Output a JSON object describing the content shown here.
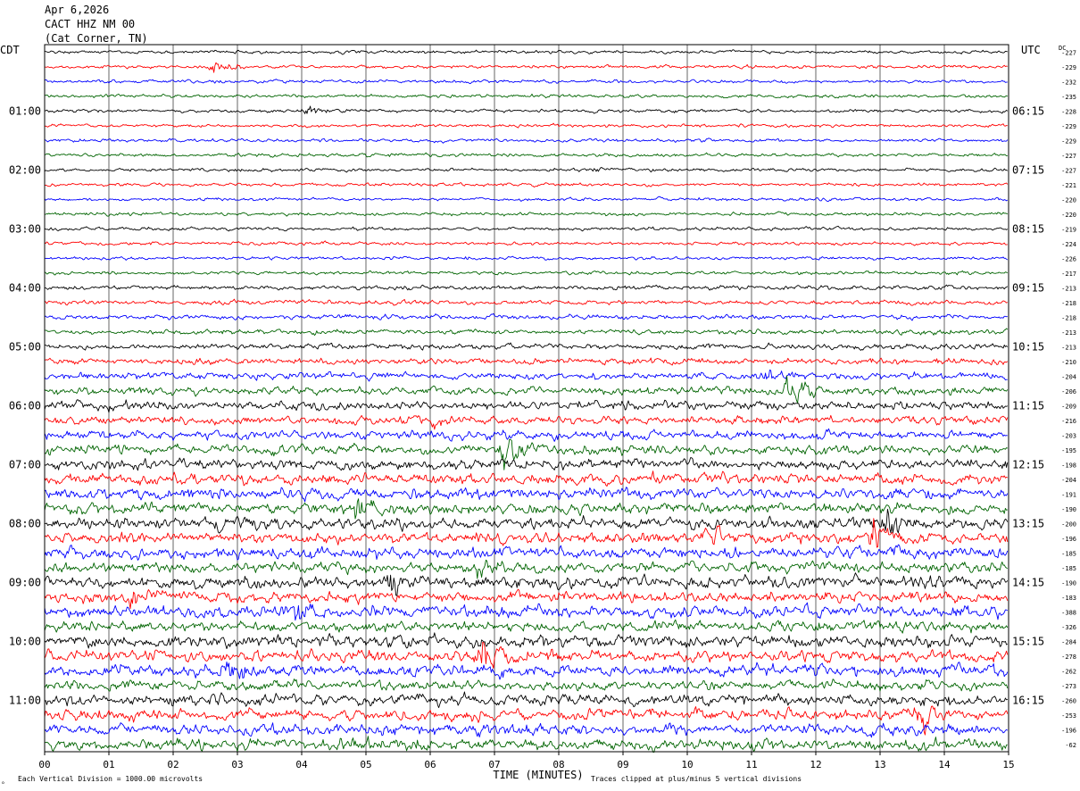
{
  "header": {
    "date": "Apr 6,2026",
    "station": "CACT HHZ NM 00",
    "location": "(Cat Corner, TN)"
  },
  "left_zone_label": "CDT",
  "right_zone_label": "UTC",
  "dc_label": "DC",
  "footer": {
    "scale_note": "Each Vertical Division = 1000.00 microvolts",
    "clip_note": "Traces clipped at plus/minus 5 vertical divisions",
    "corner_mark": "ₒ"
  },
  "colors": {
    "trace_cycle": [
      "#000000",
      "#ff0000",
      "#0000ff",
      "#006400"
    ],
    "grid": "#000000",
    "background": "#ffffff"
  },
  "chart_data": {
    "type": "line",
    "title": "",
    "xlabel": "TIME (MINUTES)",
    "ylabel": "",
    "xlim": [
      0,
      15
    ],
    "x_ticks": [
      "00",
      "01",
      "02",
      "03",
      "04",
      "05",
      "06",
      "07",
      "08",
      "09",
      "10",
      "11",
      "12",
      "13",
      "14",
      "15"
    ],
    "trace_count": 48,
    "trace_minutes": 15,
    "left_hour_labels": [
      {
        "trace": 4,
        "label": "01:00"
      },
      {
        "trace": 8,
        "label": "02:00"
      },
      {
        "trace": 12,
        "label": "03:00"
      },
      {
        "trace": 16,
        "label": "04:00"
      },
      {
        "trace": 20,
        "label": "05:00"
      },
      {
        "trace": 24,
        "label": "06:00"
      },
      {
        "trace": 28,
        "label": "07:00"
      },
      {
        "trace": 32,
        "label": "08:00"
      },
      {
        "trace": 36,
        "label": "09:00"
      },
      {
        "trace": 40,
        "label": "10:00"
      },
      {
        "trace": 44,
        "label": "11:00"
      }
    ],
    "right_hour_labels": [
      {
        "trace": 4,
        "label": "06:15"
      },
      {
        "trace": 8,
        "label": "07:15"
      },
      {
        "trace": 12,
        "label": "08:15"
      },
      {
        "trace": 16,
        "label": "09:15"
      },
      {
        "trace": 20,
        "label": "10:15"
      },
      {
        "trace": 24,
        "label": "11:15"
      },
      {
        "trace": 28,
        "label": "12:15"
      },
      {
        "trace": 32,
        "label": "13:15"
      },
      {
        "trace": 36,
        "label": "14:15"
      },
      {
        "trace": 40,
        "label": "15:15"
      },
      {
        "trace": 44,
        "label": "16:15"
      }
    ],
    "dc_offsets": [
      "-227",
      "-229",
      "-232",
      "-235",
      "-228",
      "-229",
      "-229",
      "-227",
      "-227",
      "-221",
      "-220",
      "-220",
      "-219",
      "-224",
      "-226",
      "-217",
      "-213",
      "-218",
      "-218",
      "-213",
      "-213",
      "-210",
      "-204",
      "-206",
      "-209",
      "-216",
      "-203",
      "-195",
      "-198",
      "-204",
      "-191",
      "-190",
      "-200",
      "-196",
      "-185",
      "-185",
      "-190",
      "-183",
      "-388",
      "-326",
      "-284",
      "-278",
      "-262",
      "-273",
      "-260",
      "-253",
      "-196",
      "-62"
    ],
    "trace_activity": [
      1,
      1,
      1,
      1,
      1,
      1,
      1,
      1,
      1,
      1,
      1,
      1,
      1,
      1,
      1,
      1,
      1.3,
      1.3,
      1.4,
      1.5,
      1.7,
      1.9,
      2.1,
      2.3,
      2.6,
      2.4,
      2.6,
      2.8,
      3.1,
      3.2,
      3.3,
      3.4,
      3.5,
      3.2,
      3.6,
      3.2,
      3.6,
      3.2,
      3.5,
      3.1,
      3.6,
      3.4,
      3.6,
      3.0,
      3.5,
      3.3,
      3.4,
      3.3
    ],
    "events": [
      {
        "trace": 1,
        "minute": 2.6,
        "amplitude": 5
      },
      {
        "trace": 4,
        "minute": 4.05,
        "amplitude": 3
      },
      {
        "trace": 8,
        "minute": 8.6,
        "amplitude": 2
      },
      {
        "trace": 22,
        "minute": 11.2,
        "amplitude": 6
      },
      {
        "trace": 23,
        "minute": 11.6,
        "amplitude": 9
      },
      {
        "trace": 25,
        "minute": 6.0,
        "amplitude": 3
      },
      {
        "trace": 27,
        "minute": 7.15,
        "amplitude": 10
      },
      {
        "trace": 31,
        "minute": 4.9,
        "amplitude": 6
      },
      {
        "trace": 32,
        "minute": 13.1,
        "amplitude": 9
      },
      {
        "trace": 32,
        "minute": 2.75,
        "amplitude": 4
      },
      {
        "trace": 33,
        "minute": 10.3,
        "amplitude": 6
      },
      {
        "trace": 33,
        "minute": 12.9,
        "amplitude": 10
      },
      {
        "trace": 35,
        "minute": 6.8,
        "amplitude": 5
      },
      {
        "trace": 36,
        "minute": 5.35,
        "amplitude": 9
      },
      {
        "trace": 37,
        "minute": 1.4,
        "amplitude": 6
      },
      {
        "trace": 38,
        "minute": 3.9,
        "amplitude": 5
      },
      {
        "trace": 41,
        "minute": 6.8,
        "amplitude": 10
      },
      {
        "trace": 42,
        "minute": 2.9,
        "amplitude": 8
      },
      {
        "trace": 45,
        "minute": 13.6,
        "amplitude": 8
      },
      {
        "trace": 47,
        "minute": 4.7,
        "amplitude": 8
      }
    ]
  }
}
